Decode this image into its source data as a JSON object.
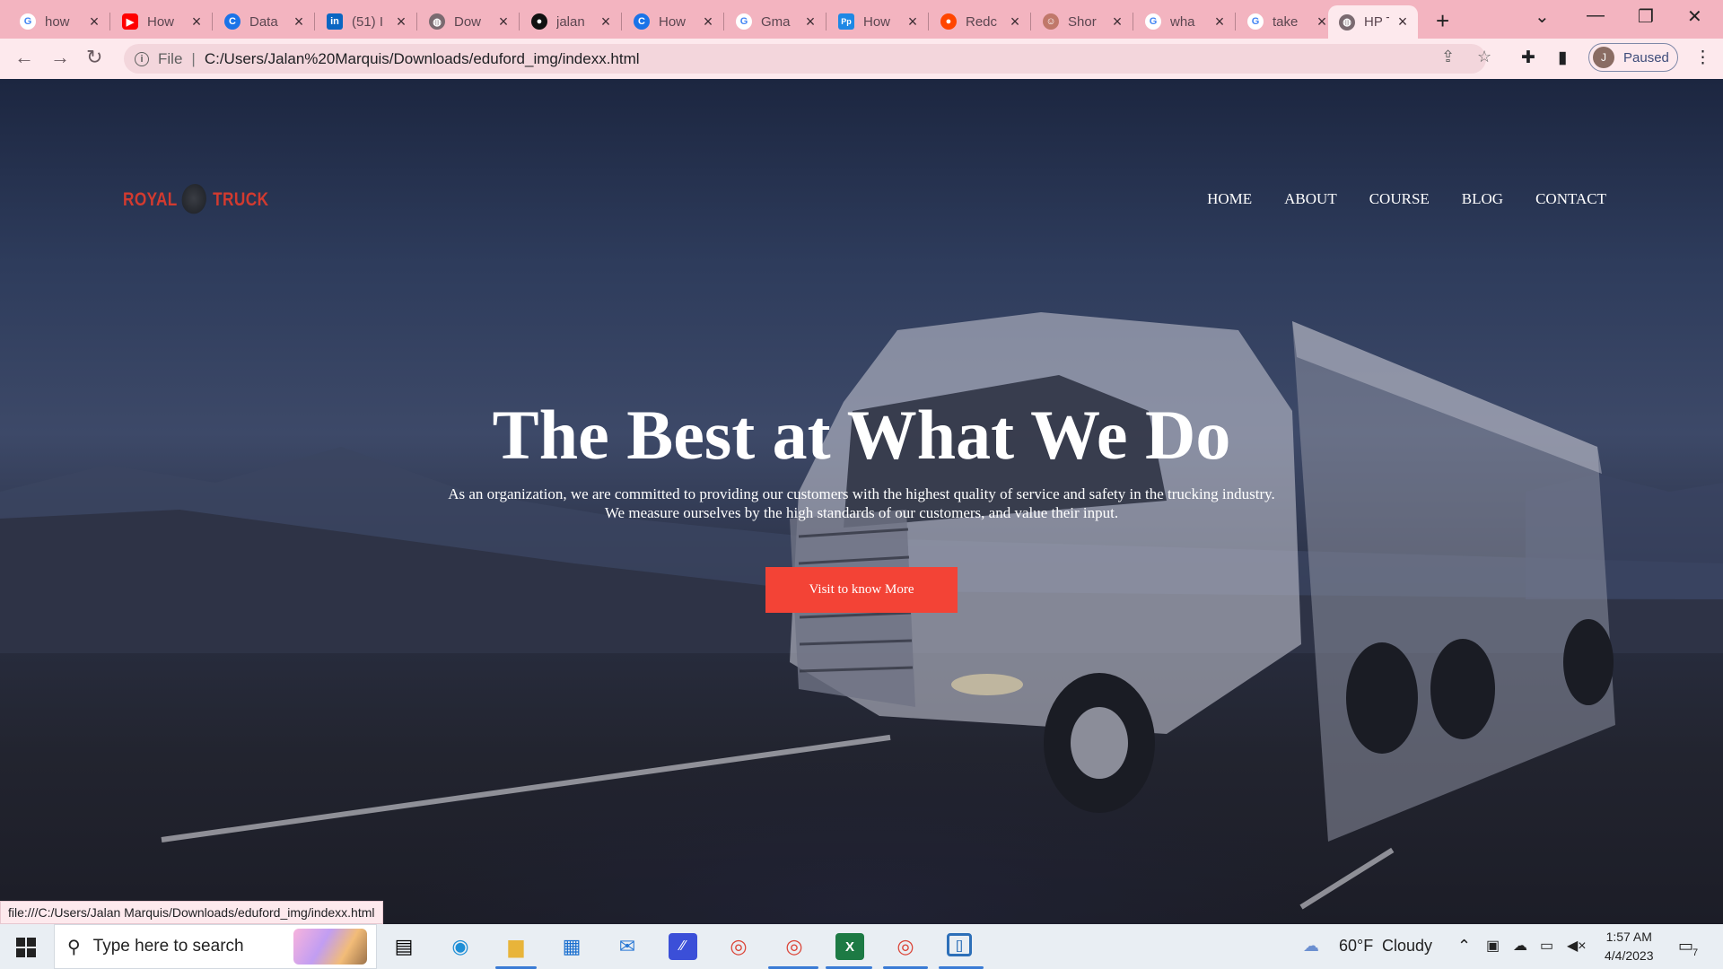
{
  "browser": {
    "tabs": [
      {
        "title": "how",
        "icon": "google-icon",
        "color": "#4285f4"
      },
      {
        "title": "How",
        "icon": "youtube-icon",
        "color": "#ff0000"
      },
      {
        "title": "Data",
        "icon": "c-icon",
        "color": "#1a73e8"
      },
      {
        "title": "(51) I",
        "icon": "linkedin-icon",
        "color": "#0a66c2"
      },
      {
        "title": "Dow",
        "icon": "globe-icon",
        "color": "#7a6a70"
      },
      {
        "title": "jalan",
        "icon": "github-icon",
        "color": "#111111"
      },
      {
        "title": "How",
        "icon": "c-icon",
        "color": "#1a73e8"
      },
      {
        "title": "Gma",
        "icon": "google-icon",
        "color": "#4285f4"
      },
      {
        "title": "How",
        "icon": "pp-icon",
        "color": "#1e88e5"
      },
      {
        "title": "Redc",
        "icon": "reddit-icon",
        "color": "#ff4500"
      },
      {
        "title": "Shor",
        "icon": "avatar-icon",
        "color": "#c0786a"
      },
      {
        "title": "wha",
        "icon": "google-icon",
        "color": "#4285f4"
      },
      {
        "title": "take",
        "icon": "google-icon",
        "color": "#4285f4"
      },
      {
        "title": "HP T",
        "icon": "globe-icon",
        "color": "#7a6a70"
      }
    ],
    "address": {
      "scheme": "File",
      "url": "C:/Users/Jalan%20Marquis/Downloads/eduford_img/indexx.html"
    },
    "profile": {
      "initial": "J",
      "status": "Paused"
    },
    "status_url": "file:///C:/Users/Jalan Marquis/Downloads/eduford_img/indexx.html"
  },
  "page": {
    "logo": {
      "left": "ROYAL",
      "right": "TRUCK"
    },
    "nav": [
      "HOME",
      "ABOUT",
      "COURSE",
      "BLOG",
      "CONTACT"
    ],
    "hero": {
      "title": "The Best at What We Do",
      "line1": "As an organization, we are committed to providing our customers with the highest quality of service and safety in the trucking industry.",
      "line2": "We measure ourselves by the high standards of our customers, and value their input.",
      "button": "Visit to know More"
    },
    "colors": {
      "accent": "#f34336",
      "logo": "#d23a2f"
    }
  },
  "taskbar": {
    "search_placeholder": "Type here to search",
    "weather": {
      "temp": "60°F",
      "condition": "Cloudy"
    },
    "time": "1:57 AM",
    "date": "4/4/2023",
    "notifications": "7"
  }
}
